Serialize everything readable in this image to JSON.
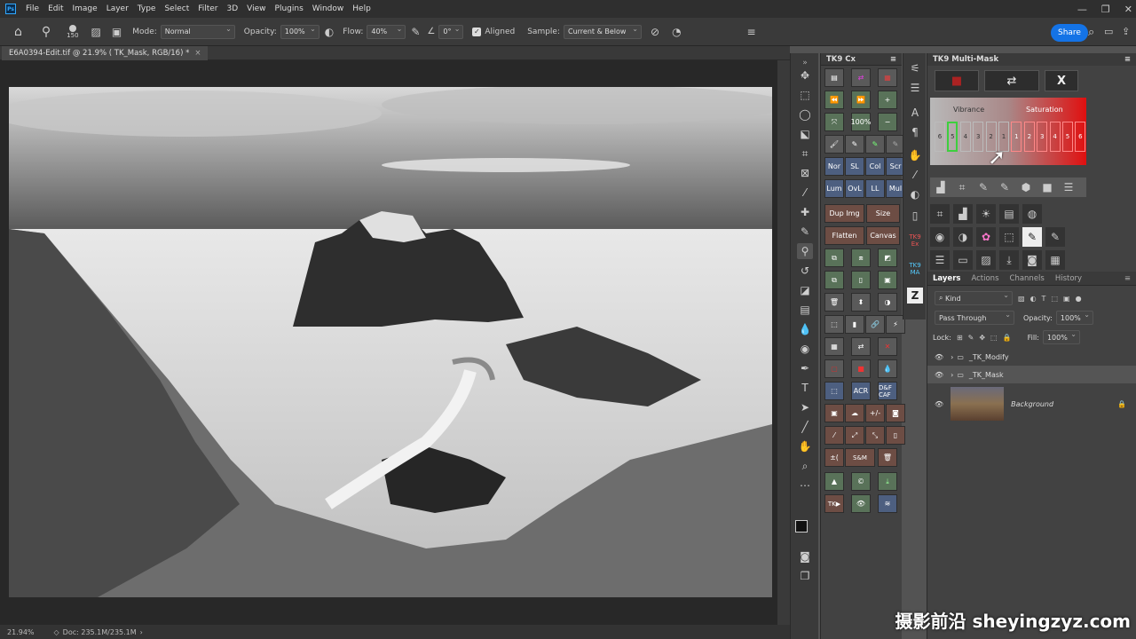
{
  "menu": [
    "File",
    "Edit",
    "Image",
    "Layer",
    "Type",
    "Select",
    "Filter",
    "3D",
    "View",
    "Plugins",
    "Window",
    "Help"
  ],
  "app_icon": "Ps",
  "options": {
    "brush_size": "150",
    "mode_label": "Mode:",
    "mode_value": "Normal",
    "opacity_label": "Opacity:",
    "opacity_value": "100%",
    "flow_label": "Flow:",
    "flow_value": "40%",
    "angle_value": "0°",
    "aligned_label": "Aligned",
    "sample_label": "Sample:",
    "sample_value": "Current & Below",
    "share_label": "Share"
  },
  "document": {
    "tab_title": "E6A0394-Edit.tif @ 21.9% ( TK_Mask, RGB/16) *",
    "zoom": "21.94%",
    "doc_size": "Doc: 235.1M/235.1M"
  },
  "tk9cx": {
    "title": "TK9 Cx",
    "buttons": {
      "zoom100": "100%",
      "nor": "Nor",
      "sl": "SL",
      "col": "Col",
      "scr": "Scr",
      "lum": "Lum",
      "ovl": "OvL",
      "ll": "LL",
      "mul": "Mul",
      "dup": "Dup Img",
      "size": "Size",
      "flatten": "Flatten",
      "canvas": "Canvas",
      "acr": "ACR",
      "dfcaf": "D&F CAF",
      "pm": "+/-",
      "pm2": "±(",
      "sm": "S&M",
      "tk": "TK▶",
      "copy": "©"
    }
  },
  "strip_labels": [
    "TK9 Ex",
    "TK9 MA"
  ],
  "multimask": {
    "title": "TK9 Multi-Mask",
    "vibrance_label": "Vibrance",
    "saturation_label": "Saturation",
    "slots": [
      "6",
      "5",
      "4",
      "3",
      "2",
      "1",
      "1",
      "2",
      "3",
      "4",
      "5",
      "6"
    ],
    "close_label": "X"
  },
  "layers_panel": {
    "tabs": [
      "Layers",
      "Actions",
      "Channels",
      "History"
    ],
    "kind": "Kind",
    "blend": "Pass Through",
    "opacity_label": "Opacity:",
    "opacity_value": "100%",
    "lock_label": "Lock:",
    "fill_label": "Fill:",
    "fill_value": "100%",
    "layers": [
      {
        "name": "_TK_Modify",
        "type": "group"
      },
      {
        "name": "_TK_Mask",
        "type": "group",
        "selected": true
      },
      {
        "name": "Background",
        "type": "image",
        "locked": true
      }
    ]
  },
  "watermark": "摄影前沿 sheyingzyz.com",
  "colors": {
    "accent": "#1473e6",
    "slot_highlight": "#3ecf3e",
    "gradient_left": "#b8b8b8",
    "gradient_right": "#e01010"
  }
}
